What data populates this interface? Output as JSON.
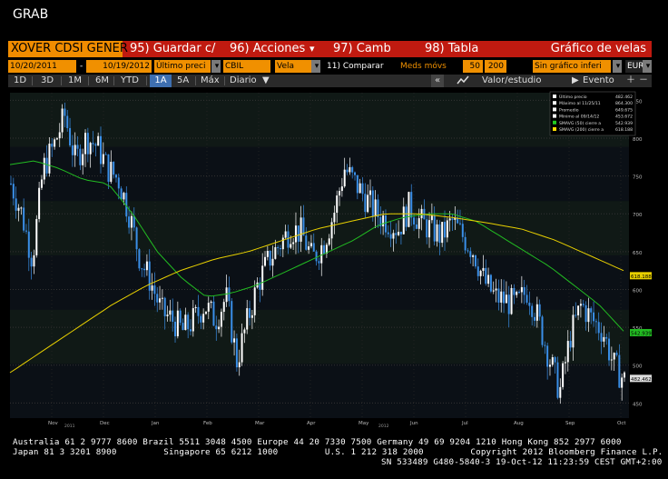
{
  "app_title": "GRAB",
  "menubar": {
    "ticker": "XOVER CDSI GENER",
    "items": [
      "95) Guardar c/",
      "96) Acciones",
      "97) Camb",
      "98) Tabla"
    ],
    "right_label": "Gráfico de velas"
  },
  "params": {
    "start_date": "10/20/2011",
    "end_date": "10/19/2012",
    "price_field": "Último preci",
    "currency_code": "CBIL",
    "chart_style": "Vela",
    "compare_label": "11) Comparar",
    "mov_avg_label": "Meds móvs",
    "ma1": "50",
    "ma2": "200",
    "lower_chart": "Sin gráfico inferi",
    "currency": "EUR"
  },
  "tabs": {
    "ranges": [
      "1D",
      "3D",
      "1M",
      "6M",
      "YTD",
      "1A",
      "5A",
      "Máx"
    ],
    "active_range": "1A",
    "frequency": "Diario",
    "valuation_label": "Valor/estudio",
    "event_label": "Evento"
  },
  "legend": [
    {
      "label": "Último precio",
      "value": "482.462",
      "color": "#ffffff"
    },
    {
      "label": "Máximo al 11/25/11",
      "value": "864.300",
      "color": "#ffffff"
    },
    {
      "label": "Promedio",
      "value": "649.675",
      "color": "#ffffff"
    },
    {
      "label": "Mínimo al 09/14/12",
      "value": "453.672",
      "color": "#ffffff"
    },
    {
      "label": "SMAVG (50) cierre a",
      "value": "542.939",
      "color": "#22cc22"
    },
    {
      "label": "SMAVG (200) cierre a",
      "value": "618.188",
      "color": "#ffdd00"
    }
  ],
  "chart_data": {
    "type": "candlestick",
    "x_tick_labels": [
      "Nov",
      "Dec",
      "Jan",
      "Feb",
      "Mar",
      "Apr",
      "May",
      "Jun",
      "Jul",
      "Aug",
      "Sep",
      "Oct"
    ],
    "year_labels": [
      "2011",
      "2012"
    ],
    "y_ticks": [
      450,
      500,
      550,
      600,
      650,
      700,
      750,
      800,
      850
    ],
    "ylim": [
      430,
      860
    ],
    "close_path": [
      740,
      700,
      640,
      760,
      790,
      830,
      770,
      800,
      790,
      760,
      745,
      700,
      640,
      610,
      570,
      560,
      545,
      560,
      580,
      560,
      590,
      505,
      560,
      610,
      640,
      660,
      680,
      675,
      640,
      660,
      700,
      760,
      740,
      720,
      700,
      690,
      680,
      710,
      690,
      680,
      670,
      690,
      670,
      650,
      610,
      590,
      585,
      580,
      600,
      560,
      510,
      465,
      540,
      580,
      560,
      545,
      500,
      480
    ],
    "sma50_path": [
      765,
      770,
      760,
      745,
      740,
      700,
      650,
      615,
      590,
      595,
      605,
      620,
      635,
      650,
      665,
      685,
      695,
      700,
      700,
      690,
      670,
      650,
      630,
      605,
      580,
      545
    ],
    "sma200_path": [
      490,
      520,
      550,
      580,
      605,
      625,
      640,
      650,
      665,
      680,
      690,
      700,
      700,
      695,
      688,
      680,
      665,
      645,
      625
    ],
    "last_price_tag": "482.462",
    "sma50_tag": "542.939",
    "sma200_tag": "618.188"
  },
  "footer": {
    "line1": "Australia 61 2 9777 8600 Brazil 5511 3048 4500 Europe 44 20 7330 7500 Germany 49 69 9204 1210 Hong Kong 852 2977 6000",
    "line2": "Japan 81 3 3201 8900         Singapore 65 6212 1000         U.S. 1 212 318 2000         Copyright 2012 Bloomberg Finance L.P.",
    "line3": "SN 533489 G480-5840-3 19-Oct-12 11:23:59 CEST GMT+2:00"
  }
}
